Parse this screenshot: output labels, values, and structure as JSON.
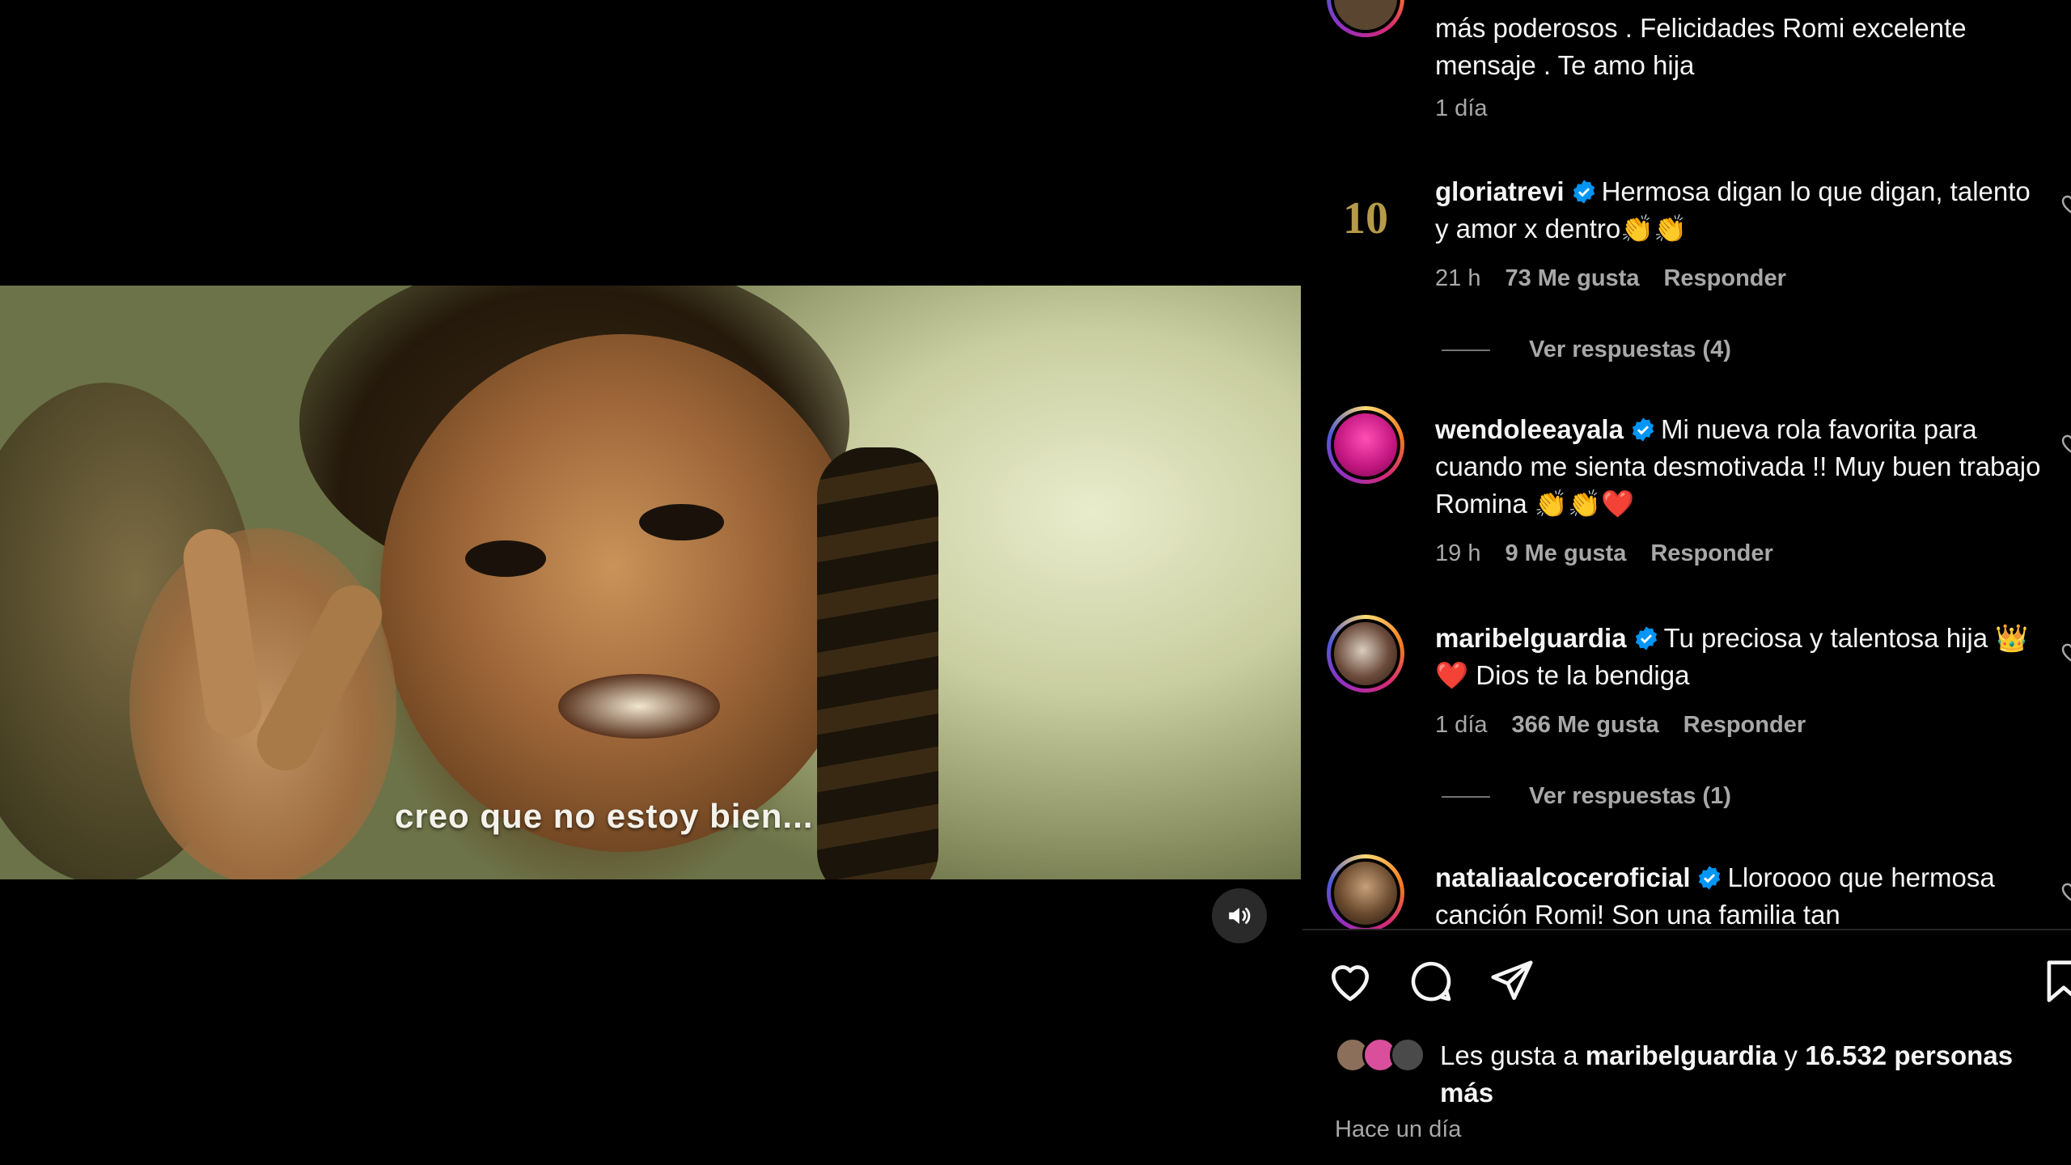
{
  "video": {
    "subtitle": "creo que no estoy bien...",
    "mute_icon": "speaker-volume-icon"
  },
  "comments": {
    "partial_top": {
      "text_line1": "más poderosos . Felicidades Romi excelente",
      "text_line2": "mensaje . Te amo hija",
      "time": "1 día"
    },
    "items": [
      {
        "username": "gloriatrevi",
        "text": "Hermosa digan lo que digan, talento y amor x dentro👏👏",
        "time": "21 h",
        "likes": "73 Me gusta",
        "reply": "Responder",
        "view_replies": "Ver respuestas (4)",
        "avatar_text": "10"
      },
      {
        "username": "wendoleeayala",
        "text": "Mi nueva rola favorita para cuando me sienta desmotivada !! Muy buen trabajo Romina 👏👏❤️",
        "time": "19 h",
        "likes": "9 Me gusta",
        "reply": "Responder"
      },
      {
        "username": "maribelguardia",
        "text": "Tu preciosa y talentosa hija 👑❤️ Dios te la bendiga",
        "time": "1 día",
        "likes": "366 Me gusta",
        "reply": "Responder",
        "view_replies": "Ver respuestas (1)"
      },
      {
        "username": "nataliaalcoceroficial",
        "text": "Lloroooo que hermosa canción Romi! Son una familia tan"
      }
    ]
  },
  "likes": {
    "prefix": "Les gusta a ",
    "user": "maribelguardia",
    "middle": " y ",
    "count": "16.532 personas",
    "suffix": "más"
  },
  "post_time": "Hace un día",
  "colors": {
    "verified": "#0095f6",
    "secondary_text": "#a8a8a8",
    "divider": "#262626"
  }
}
